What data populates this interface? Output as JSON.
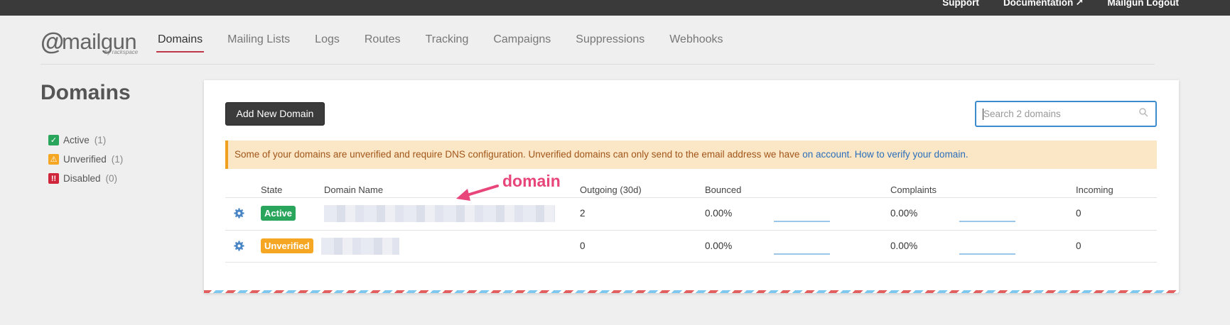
{
  "topbar": {
    "support": "Support",
    "documentation": "Documentation",
    "logout": "Mailgun Logout"
  },
  "logo": {
    "at": "@",
    "word": "mailgun",
    "sub": "by rackspace"
  },
  "nav": [
    {
      "label": "Domains",
      "active": true
    },
    {
      "label": "Mailing Lists"
    },
    {
      "label": "Logs"
    },
    {
      "label": "Routes"
    },
    {
      "label": "Tracking"
    },
    {
      "label": "Campaigns"
    },
    {
      "label": "Suppressions"
    },
    {
      "label": "Webhooks"
    }
  ],
  "page_title": "Domains",
  "filters": [
    {
      "label": "Active",
      "count": "(1)",
      "icon": "check-icon",
      "color": "#2aa65c"
    },
    {
      "label": "Unverified",
      "count": "(1)",
      "icon": "warning-icon",
      "color": "#f5a623"
    },
    {
      "label": "Disabled",
      "count": "(0)",
      "icon": "exclamation-icon",
      "color": "#d0263c"
    }
  ],
  "toolbar": {
    "add_label": "Add New Domain",
    "search_placeholder": "Search 2 domains"
  },
  "alert": {
    "text": "Some of your domains are unverified and require DNS configuration. Unverified domains can only send to the email address we have ",
    "link1": "on account",
    "sep": ". ",
    "link2": "How to verify your domain."
  },
  "table": {
    "headers": [
      "State",
      "Domain Name",
      "Outgoing (30d)",
      "Bounced",
      "Complaints",
      "Incoming"
    ],
    "rows": [
      {
        "state": "Active",
        "outgoing": "2",
        "bounced": "0.00%",
        "complaints": "0.00%",
        "incoming": "0"
      },
      {
        "state": "Unverified",
        "outgoing": "0",
        "bounced": "0.00%",
        "complaints": "0.00%",
        "incoming": "0"
      }
    ]
  },
  "annotation": {
    "text": "domain",
    "color": "#e8457a"
  },
  "colors": {
    "accent": "#c0394b",
    "active": "#2aa65c",
    "unverified": "#f5a623",
    "link": "#2a6ebb"
  }
}
